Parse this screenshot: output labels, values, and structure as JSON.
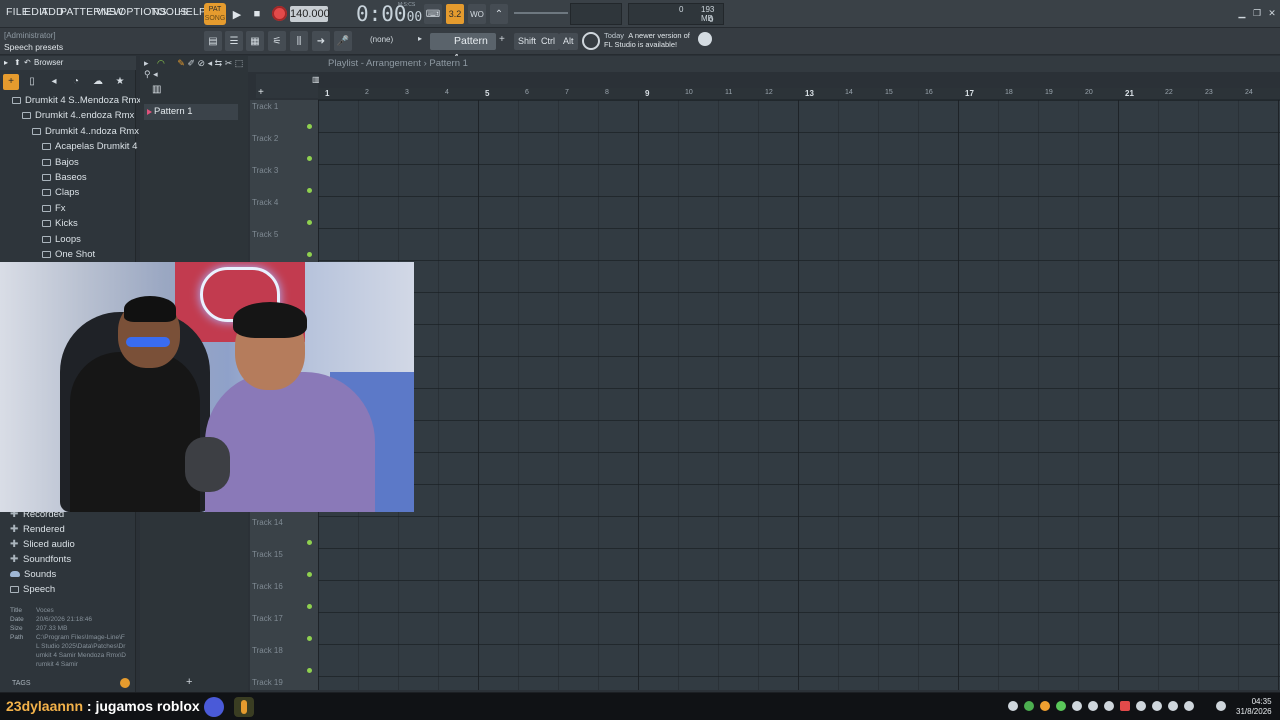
{
  "menu": [
    "FILE",
    "EDIT",
    "ADD",
    "PATTERNS",
    "VIEW",
    "OPTIONS",
    "TOOLS",
    "HELP"
  ],
  "transport": {
    "pat_label": "PAT",
    "song_label": "SONG",
    "tempo": "140.000",
    "time": "0:00",
    "time_small": "00",
    "time_units": "M:S:CS"
  },
  "memory": {
    "value_a": "0",
    "mb": "193 MB",
    "value_b": "0"
  },
  "hint": {
    "line1": "[Administrator]",
    "line2": "Speech presets"
  },
  "toolbar2": {
    "snap": "(none)",
    "pattern": "Pattern 1",
    "shift": "Shift",
    "ctrl": "Ctrl",
    "alt": "Alt",
    "news_prefix": "Today",
    "news_line1": "A newer version of",
    "news_line2": "FL Studio is available!"
  },
  "browser": {
    "title": "Browser",
    "tree_top": [
      {
        "label": "Drumkit 4 S..Mendoza Rmx",
        "indent": 0
      },
      {
        "label": "Drumkit 4..endoza Rmx",
        "indent": 1
      },
      {
        "label": "Drumkit 4..ndoza Rmx",
        "indent": 2
      },
      {
        "label": "Acapelas Drumkit 4",
        "indent": 3
      },
      {
        "label": "Bajos",
        "indent": 3
      },
      {
        "label": "Baseos",
        "indent": 3
      },
      {
        "label": "Claps",
        "indent": 3
      },
      {
        "label": "Fx",
        "indent": 3
      },
      {
        "label": "Kicks",
        "indent": 3
      },
      {
        "label": "Loops",
        "indent": 3
      },
      {
        "label": "One Shot",
        "indent": 3
      }
    ],
    "tree_bottom": [
      {
        "label": "Recorded",
        "icon": "plus"
      },
      {
        "label": "Rendered",
        "icon": "plus"
      },
      {
        "label": "Sliced audio",
        "icon": "plus"
      },
      {
        "label": "Soundfonts",
        "icon": "plus"
      },
      {
        "label": "Sounds",
        "icon": "cloud"
      },
      {
        "label": "Speech",
        "icon": "folder"
      }
    ],
    "info": {
      "title_label": "Title",
      "title": "Voces",
      "date_label": "Date",
      "date": "20/6/2026 21:18:46",
      "size_label": "Size",
      "size": "207.33 MB",
      "path_label": "Path",
      "path": "C:\\Program Files\\Image-Line\\FL Studio 2025\\Data\\Patches\\Drumkit 4 Samir Mendoza Rmx\\Drumkit 4 Samir"
    },
    "tags": "TAGS"
  },
  "patterns": {
    "items": [
      "Pattern 1"
    ],
    "add": "+"
  },
  "playlist": {
    "breadcrumb": "Playlist - Arrangement › Pattern 1",
    "bars": [
      "1",
      "2",
      "3",
      "4",
      "5",
      "6",
      "7",
      "8",
      "9",
      "10",
      "11",
      "12",
      "13",
      "14",
      "15",
      "16",
      "17",
      "18",
      "19",
      "20",
      "21",
      "22",
      "23",
      "24"
    ],
    "tracks_top": [
      "Track 1",
      "Track 2",
      "Track 3",
      "Track 4",
      "Track 5"
    ],
    "tracks_bottom": [
      "Track 14",
      "Track 15",
      "Track 16",
      "Track 17",
      "Track 18",
      "Track 19"
    ]
  },
  "overlay": {
    "user": "23dylaannn",
    "message": " : jugamos roblox"
  },
  "clock": {
    "time": "04:35",
    "date": "31/8/2026"
  },
  "colors": {
    "accent": "#e59b2e",
    "record": "#e24a4a",
    "track_dot": "#8fd14f",
    "pattern_marker": "#e0537c"
  }
}
